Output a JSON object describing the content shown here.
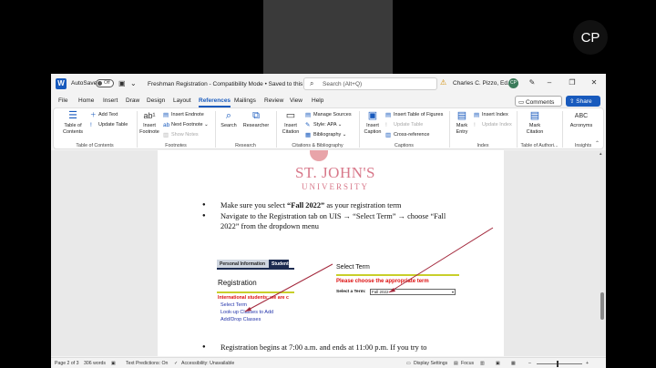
{
  "video": {
    "initials": "CP"
  },
  "titlebar": {
    "logo": "W",
    "autosave_label": "AutoSave",
    "autosave_state": "Off",
    "doc_title": "Freshman Registration  -  Compatibility Mode • Saved to this PC ⌄",
    "search_placeholder": "Search (Alt+Q)",
    "user_name": "Charles C. Pizzo, Ed.D.",
    "user_initials": "CP"
  },
  "menu": {
    "items": [
      "File",
      "Home",
      "Insert",
      "Draw",
      "Design",
      "Layout",
      "References",
      "Mailings",
      "Review",
      "View",
      "Help"
    ],
    "active": "References",
    "comments_label": "Comments",
    "share_label": "Share"
  },
  "ribbon": {
    "toc": {
      "big": "Table of\nContents",
      "add_text": "Add Text",
      "update_table": "Update Table",
      "group": "Table of Contents"
    },
    "footnotes": {
      "insert_footnote": "Insert\nFootnote",
      "insert_endnote": "Insert Endnote",
      "next_footnote": "Next Footnote",
      "show_notes": "Show Notes",
      "group": "Footnotes"
    },
    "research": {
      "search": "Search",
      "researcher": "Researcher",
      "group": "Research"
    },
    "citations": {
      "insert_citation": "Insert\nCitation",
      "manage_sources": "Manage Sources",
      "style": "Style: APA",
      "bibliography": "Bibliography",
      "group": "Citations & Bibliography"
    },
    "captions": {
      "insert_caption": "Insert\nCaption",
      "insert_tof": "Insert Table of Figures",
      "update_table": "Update Table",
      "cross_reference": "Cross-reference",
      "group": "Captions"
    },
    "index": {
      "mark_entry": "Mark\nEntry",
      "insert_index": "Insert Index",
      "update_index": "Update Index",
      "group": "Index"
    },
    "toa": {
      "mark_citation": "Mark\nCitation",
      "group": "Table of Authori..."
    },
    "insights": {
      "acronyms": "Acronyms",
      "group": "Insights"
    }
  },
  "document": {
    "logo_line1": "ST. JOHN'S",
    "logo_line2": "UNIVERSITY",
    "bullet1_pre": "Make sure you select ",
    "bullet1_bold": "“Fall 2022”",
    "bullet1_post": " as your registration term",
    "bullet2_line1": "Navigate to the Registration tab on UIS → “Select Term” → choose “Fall",
    "bullet2_line2": "2022” from the dropdown menu",
    "bullet3_line1": "Registration begins at 7:00 a.m. and ends at 11:00 p.m.  If you try to",
    "uis": {
      "tab_personal": "Personal Information",
      "tab_student": "Student",
      "reg_title": "Registration",
      "intl_text": "International students: we are c",
      "links": [
        "Select Term",
        "Look-up Classes to Add",
        "Add/Drop Classes"
      ],
      "select_term_title": "Select Term",
      "select_prompt": "Please choose the appropriate term",
      "select_label": "Select a Term:",
      "select_value": "Fall 2022"
    }
  },
  "status": {
    "page": "Page 2 of 3",
    "words": "306 words",
    "text_predictions": "Text Predictions: On",
    "accessibility": "Accessibility: Unavailable",
    "display_settings": "Display Settings",
    "focus": "Focus"
  },
  "colors": {
    "word_blue": "#185abd",
    "sju_red": "#d8788a",
    "arrow": "#a3283c"
  }
}
